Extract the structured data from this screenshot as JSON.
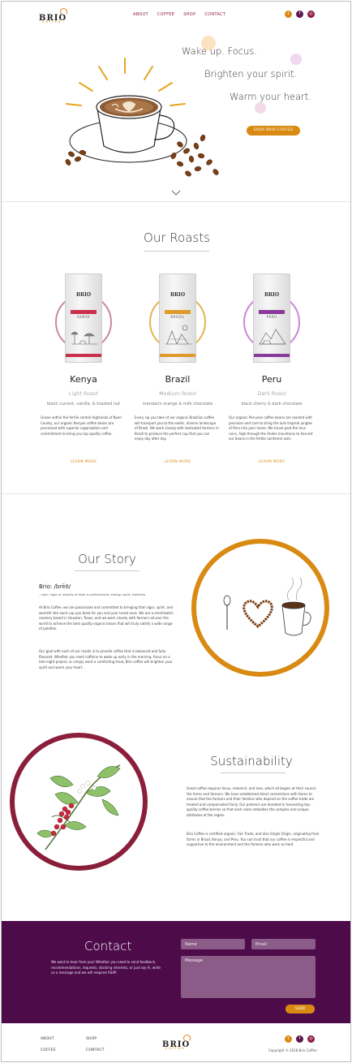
{
  "brand": {
    "name": "BRIO",
    "sub": "coffee"
  },
  "nav": {
    "about": "ABOUT",
    "coffee": "COFFEE",
    "shop": "SHOP",
    "contact": "CONTACT"
  },
  "hero": {
    "line1": "Wake up. Focus.",
    "line2": "Brighten your spirit.",
    "line3": "Warm your heart.",
    "cta": "SHOP BRIO COFFEE"
  },
  "roasts": {
    "title": "Our Roasts",
    "items": [
      {
        "name": "Kenya",
        "roast": "Light Roast",
        "notes": "black currant, vanilla, & toasted nut",
        "description": "Grown within the fertile central highlands of Nyeri County, our organic Kenyan coffee beans are processed with superior organization and commitment to bring you top quality coffee.",
        "link": "LEARN MORE",
        "bag_label": "KENYA",
        "bag_roast": "LIGHT ROAST",
        "accent": "#c9314a",
        "ring": "#c98a98"
      },
      {
        "name": "Brazil",
        "roast": "Medium Roast",
        "notes": "mandarin orange & milk chocolate",
        "description": "Every sip you take of our organic Brazilian coffee will transport you to the exotic, diverse landscape of Brazil. We work closely with dedicated farmers in Brazil to produce the perfect cup that you can enjoy day after day.",
        "link": "LEARN MORE",
        "bag_label": "BRAZIL",
        "bag_roast": "MEDIUM ROAST",
        "accent": "#e09a2a",
        "ring": "#e6b450"
      },
      {
        "name": "Peru",
        "roast": "Dark Roast",
        "notes": "black cherry & dark chocolate",
        "description": "Our organic Peruvian coffee beans are roasted with precision and care to bring the lush tropical jungles of Peru into your home. We travel past the Inca ruins, high through the Andes mountains to harvest our beans in the fertile rainforest soils.",
        "link": "LEARN MORE",
        "bag_label": "PERU",
        "bag_roast": "DARK ROAST",
        "accent": "#8a3a9a",
        "ring": "#c889d3"
      }
    ]
  },
  "story": {
    "title": "Our Story",
    "word": "Brio: /brēō/",
    "definition": "- noun: vigor or vivacity of style or performance; energy; spirit; liveliness",
    "p1": "At Brio Coffee, we are passionate and committed to bringing that vigor, spirit, and warmth into each cup you brew for you and your loved ones. We are a small-batch roastery based in Houston, Texas, and we work closely with farmers all over the world to achieve the best quality organic beans that will truly satisfy a wide range of palettes.",
    "p2": "Our goal with each of our roasts is to provide coffee that is balanced and fully-flavored. Whether you need caffeine to wake up early in the morning, focus on a late-night project, or simply want a comforting treat, Brio coffee will brighten your spirit and warm your heart."
  },
  "sustainability": {
    "title": "Sustainability",
    "p1": "Great coffee requires focus, research, and love, which all begins at their source: the farms and farmers. We have established direct connections with farms to ensure that the farmers and their families who depend on the coffee trade are treated and compensated fairly. Our partners are devoted to harvesting top-quality coffee berries so that each roast embodies the complex and unique attributes of the region.",
    "p2": "Brio Coffee is certified organic, Fair Trade, and also Single Origin, originating from farms in Brazil, Kenya, and Peru. You can trust that our coffee is respectful and supportive to the environment and the farmers who work so hard."
  },
  "contact": {
    "title": "Contact",
    "text": "We want to hear from you! Whether you need to send feedback, recommendations, requests, stocking interests, or just say hi, write us a message and we will respond ASAP.",
    "name_placeholder": "Name",
    "email_placeholder": "Email",
    "message_placeholder": "Message",
    "send": "SEND"
  },
  "footer": {
    "about": "ABOUT",
    "shop": "SHOP",
    "coffee": "COFFEE",
    "contact": "CONTACT",
    "copyright": "Copyright © 2018 Brio Coffee"
  },
  "social": {
    "twitter": "t",
    "facebook": "f",
    "instagram": "◎"
  },
  "colors": {
    "orange": "#d88a12",
    "plum": "#4d0b4a",
    "wine": "#8b1e3a"
  },
  "icons": [
    "twitter-icon",
    "facebook-icon",
    "instagram-icon",
    "chevron-down-icon"
  ]
}
